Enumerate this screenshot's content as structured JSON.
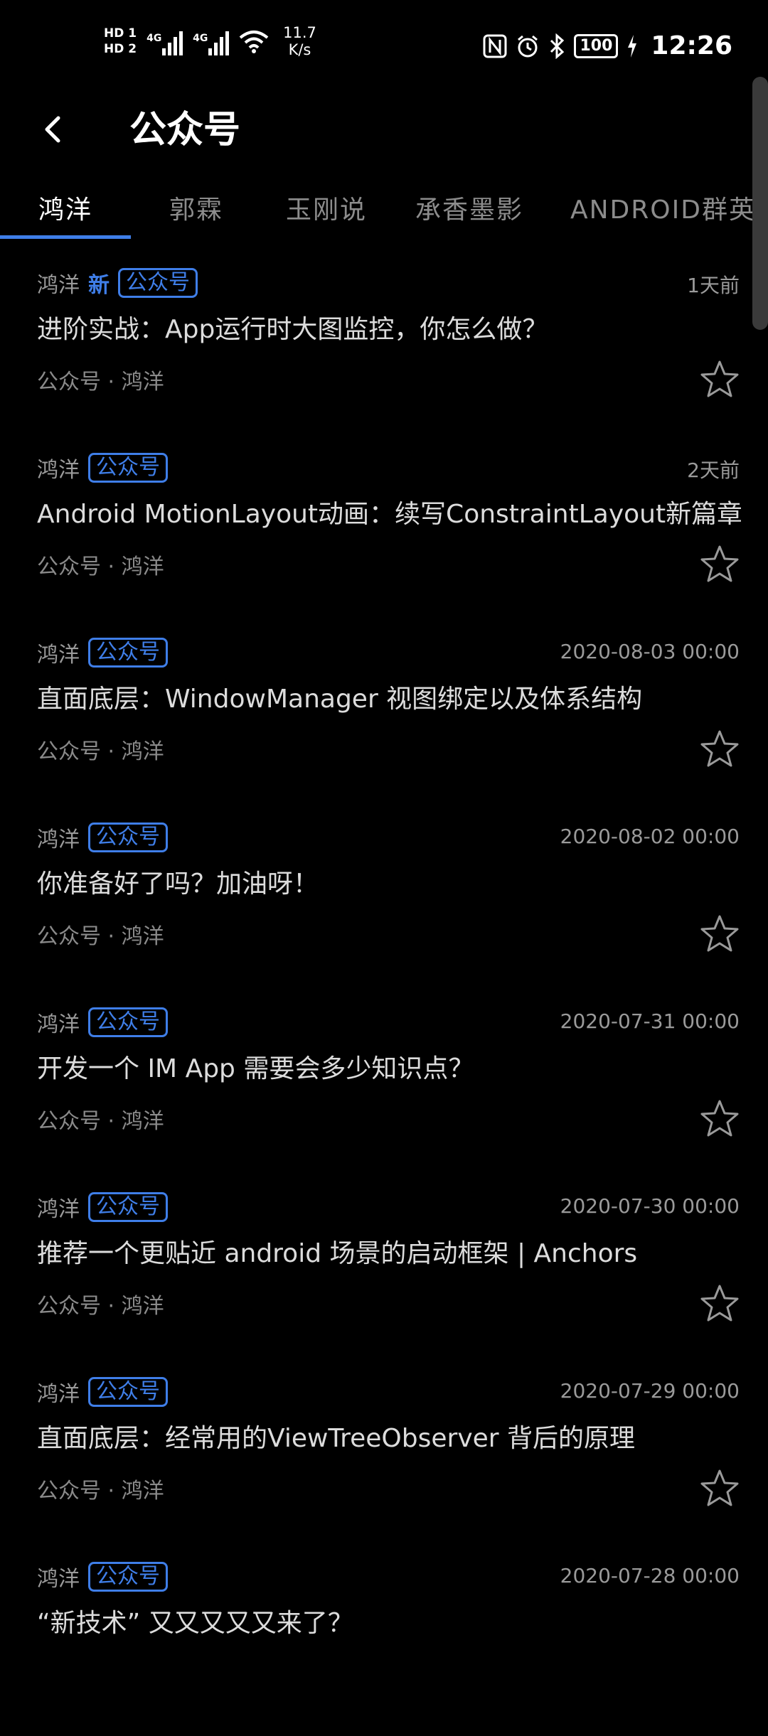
{
  "status_bar": {
    "hd1": "HD 1",
    "hd2": "HD 2",
    "net1": "4G",
    "net2": "4G",
    "speed_value": "11.7",
    "speed_unit": "K/s",
    "battery": "100",
    "time": "12:26",
    "icons": [
      "nfc-icon",
      "alarm-icon",
      "bluetooth-icon",
      "battery-icon",
      "charging-icon"
    ]
  },
  "header": {
    "title": "公众号"
  },
  "tabs": [
    "鸿洋",
    "郭霖",
    "玉刚说",
    "承香墨影",
    "ANDROID群英传"
  ],
  "articles": [
    {
      "author": "鸿洋",
      "new": "新",
      "tag": "公众号",
      "date": "1天前",
      "title": "进阶实战：App运行时大图监控，你怎么做？",
      "source": "公众号 · 鸿洋"
    },
    {
      "author": "鸿洋",
      "new": "",
      "tag": "公众号",
      "date": "2天前",
      "title": "Android MotionLayout动画：续写ConstraintLayout新篇章",
      "source": "公众号 · 鸿洋"
    },
    {
      "author": "鸿洋",
      "new": "",
      "tag": "公众号",
      "date": "2020-08-03 00:00",
      "title": "直面底层：WindowManager 视图绑定以及体系结构",
      "source": "公众号 · 鸿洋"
    },
    {
      "author": "鸿洋",
      "new": "",
      "tag": "公众号",
      "date": "2020-08-02 00:00",
      "title": "你准备好了吗？加油呀！",
      "source": "公众号 · 鸿洋"
    },
    {
      "author": "鸿洋",
      "new": "",
      "tag": "公众号",
      "date": "2020-07-31 00:00",
      "title": "开发一个 IM App 需要会多少知识点？",
      "source": "公众号 · 鸿洋"
    },
    {
      "author": "鸿洋",
      "new": "",
      "tag": "公众号",
      "date": "2020-07-30 00:00",
      "title": "推荐一个更贴近 android 场景的启动框架 | Anchors",
      "source": "公众号 · 鸿洋"
    },
    {
      "author": "鸿洋",
      "new": "",
      "tag": "公众号",
      "date": "2020-07-29 00:00",
      "title": "直面底层：经常用的ViewTreeObserver 背后的原理",
      "source": "公众号 · 鸿洋"
    },
    {
      "author": "鸿洋",
      "new": "",
      "tag": "公众号",
      "date": "2020-07-28 00:00",
      "title": "“新技术” 又又又又又来了？",
      "source": ""
    }
  ],
  "colors": {
    "accent": "#3f7ee8",
    "background": "#000000"
  }
}
